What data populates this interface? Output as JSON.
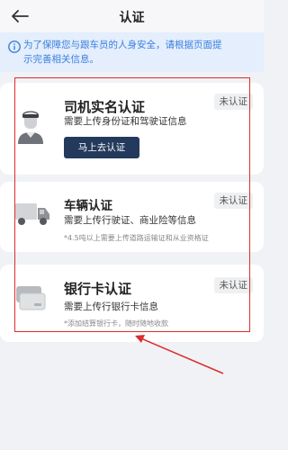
{
  "header": {
    "title": "认证",
    "back_icon": "arrow-left-icon"
  },
  "notice": {
    "icon": "info-icon",
    "text": "为了保障您与跟车员的人身安全，请根据页面提\n示完善相关信息。",
    "color": "#3a7fe0"
  },
  "cards": [
    {
      "title": "司机实名认证",
      "icon": "driver-avatar-icon",
      "badge": "未认证",
      "desc": "需要上传身份证和驾驶证信息",
      "button_label": "马上去认证"
    },
    {
      "title": "车辆认证",
      "icon": "truck-icon",
      "badge": "未认证",
      "desc": "需要上传行驶证、商业险等信息",
      "note": "*4.5吨以上需要上传道路运输证和从业资格证"
    },
    {
      "title": "银行卡认证",
      "icon": "bank-card-icon",
      "badge": "未认证",
      "desc": "需要上传行银行卡信息",
      "note": "*添加结算银行卡，随时随地收款"
    }
  ],
  "colors": {
    "accent_button": "#243a5c",
    "annotation_red": "#d9302f",
    "notice_bg": "#e4eefc"
  }
}
